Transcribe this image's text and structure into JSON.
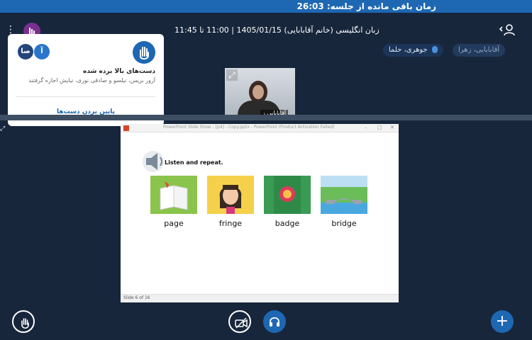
{
  "topbar": {
    "time_remaining": "زمان باقی مانده از جلسه: 26:03"
  },
  "header": {
    "title": "زبان انگلیسی (خانم آقابابایی) 1405/01/15 | 11:00 تا 11:45"
  },
  "presenters": [
    {
      "name": "جوهری، حلما"
    },
    {
      "name": "آقابابایی، زهرا"
    }
  ],
  "raise_hand_popup": {
    "avatars": [
      "آ",
      "صا"
    ],
    "title": "دست‌های بالا برده شده",
    "names": "آزور بریس، نیلسو و صادقی نوری، نیایش اجازه گرفتند",
    "lower_all": "پایین بردن دست‌ها"
  },
  "webcam": {
    "name": "آقابابایی ز"
  },
  "presentation": {
    "window_title": "PowerPoint Slide Show - [p4] - Copy.pptx - PowerPoint (Product Activation Failed)",
    "instruction": "Listen and repeat.",
    "words": [
      "page",
      "fringe",
      "badge",
      "bridge"
    ],
    "slide_info": "Slide 6 of 16"
  },
  "colors": {
    "topbar": "#1e67b3",
    "background": "#17263b",
    "accent": "#1e67b3"
  },
  "icons": {
    "hand": "raise-hand-icon",
    "camera": "camera-off-icon",
    "audio": "headphones-icon",
    "plus": "plus-icon",
    "users": "user-list-icon"
  }
}
